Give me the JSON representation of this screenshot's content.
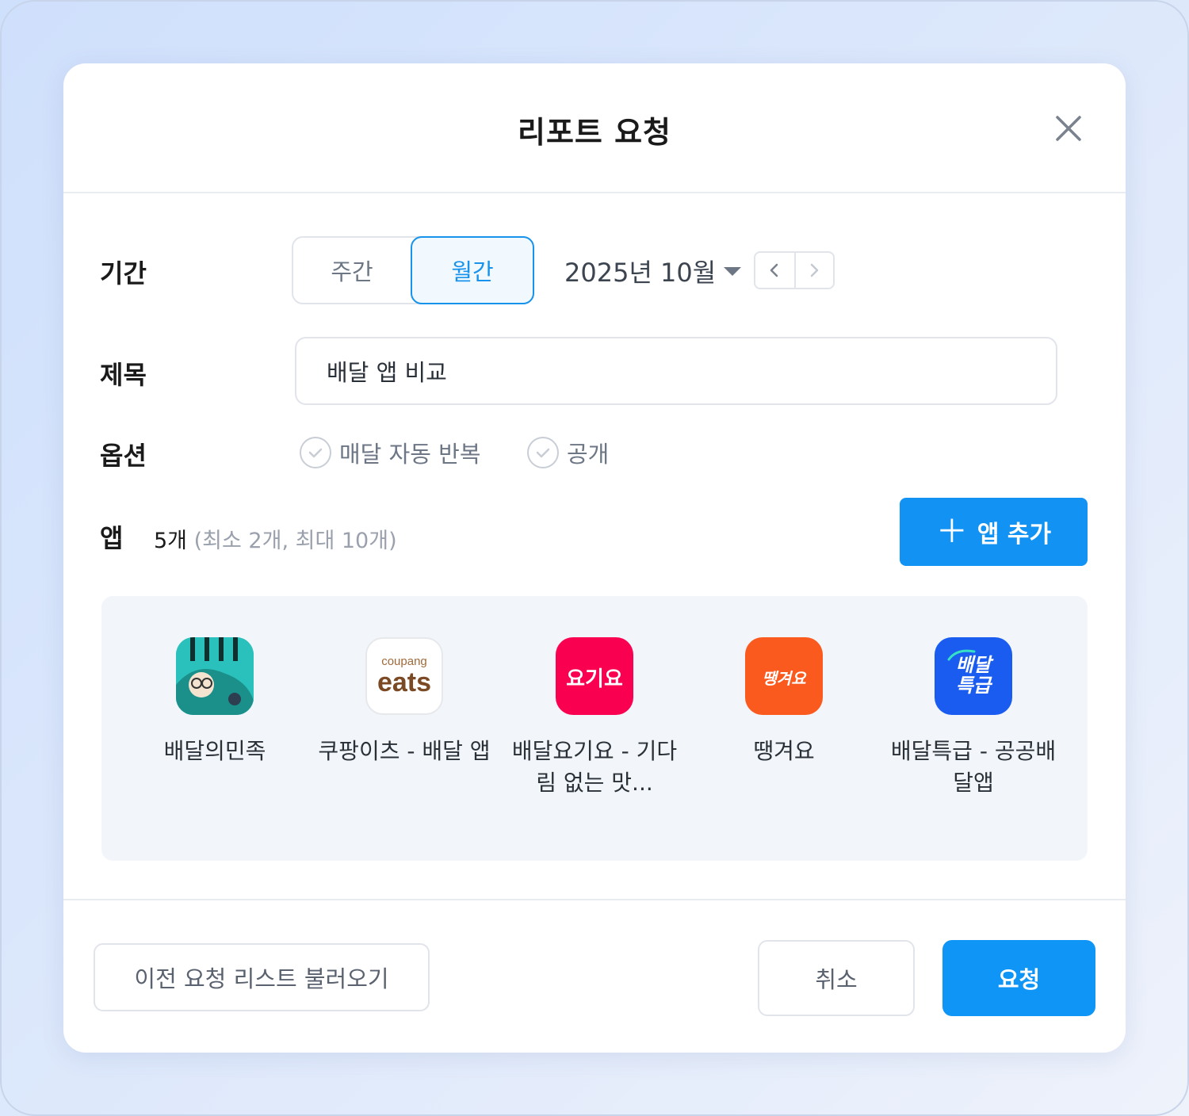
{
  "dialog": {
    "title": "리포트 요청",
    "close_icon": "close-icon"
  },
  "period": {
    "label": "기간",
    "options": [
      "주간",
      "월간"
    ],
    "selected": "월간",
    "month": "2025년 10월",
    "prev_icon": "chevron-left-icon",
    "next_icon": "chevron-right-icon"
  },
  "report_title": {
    "label": "제목",
    "value": "배달 앱 비교"
  },
  "options": {
    "label": "옵션",
    "items": [
      {
        "label": "매달 자동 반복",
        "checked": false
      },
      {
        "label": "공개",
        "checked": false
      }
    ]
  },
  "apps": {
    "label": "앱",
    "count": "5개",
    "limit": "(최소 2개, 최대 10개)",
    "add_label": "앱 추가",
    "add_icon": "plus-icon",
    "items": [
      {
        "name": "배달의민족",
        "icon": "baemin-app-icon",
        "color": "#2ac1bc"
      },
      {
        "name": "쿠팡이츠 - 배달 앱",
        "icon": "coupang-eats-app-icon",
        "color": "#ffffff",
        "icon_text_small": "coupang",
        "icon_text_big": "eats"
      },
      {
        "name": "배달요기요 - 기다림 없는 맛...",
        "icon": "yogiyo-app-icon",
        "color": "#fa0050",
        "icon_text": "요기요"
      },
      {
        "name": "땡겨요",
        "icon": "ddangyo-app-icon",
        "color": "#fa5a1e",
        "icon_text": "땡겨요"
      },
      {
        "name": "배달특급 - 공공배달앱",
        "icon": "baedal-teukgeup-app-icon",
        "color": "#1a5cf0",
        "icon_text_line1": "배달",
        "icon_text_line2": "특급"
      }
    ]
  },
  "footer": {
    "load_previous": "이전 요청 리스트 불러오기",
    "cancel": "취소",
    "submit": "요청"
  },
  "colors": {
    "accent": "#1293f4",
    "panel_bg": "#f2f6fa"
  }
}
